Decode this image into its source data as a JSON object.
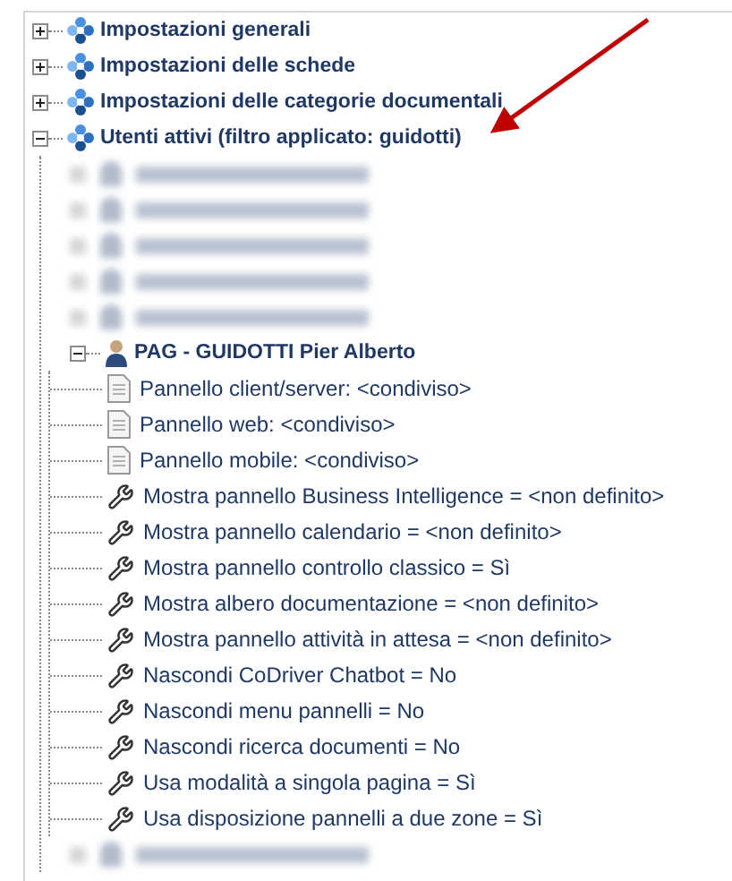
{
  "tree": [
    {
      "kind": "group",
      "label": "Impostazioni generali",
      "expanded": false
    },
    {
      "kind": "group",
      "label": "Impostazioni delle schede",
      "expanded": false
    },
    {
      "kind": "group",
      "label": "Impostazioni delle categorie documentali",
      "expanded": false
    },
    {
      "kind": "group",
      "label": "Utenti attivi (filtro applicato: guidotti)",
      "expanded": true,
      "children": [
        {
          "kind": "redacted"
        },
        {
          "kind": "redacted"
        },
        {
          "kind": "redacted"
        },
        {
          "kind": "redacted"
        },
        {
          "kind": "redacted"
        },
        {
          "kind": "user",
          "label": "PAG - GUIDOTTI Pier Alberto",
          "expanded": true,
          "children": [
            {
              "kind": "document",
              "label": "Pannello client/server: <condiviso>"
            },
            {
              "kind": "document",
              "label": "Pannello web: <condiviso>"
            },
            {
              "kind": "document",
              "label": "Pannello mobile: <condiviso>"
            },
            {
              "kind": "setting",
              "label": "Mostra pannello Business Intelligence = <non definito>"
            },
            {
              "kind": "setting",
              "label": "Mostra pannello calendario = <non definito>"
            },
            {
              "kind": "setting",
              "label": "Mostra pannello controllo classico = Sì"
            },
            {
              "kind": "setting",
              "label": "Mostra albero documentazione = <non definito>"
            },
            {
              "kind": "setting",
              "label": "Mostra pannello attività in attesa = <non definito>"
            },
            {
              "kind": "setting",
              "label": "Nascondi CoDriver Chatbot = No"
            },
            {
              "kind": "setting",
              "label": "Nascondi menu pannelli = No"
            },
            {
              "kind": "setting",
              "label": "Nascondi ricerca documenti = No"
            },
            {
              "kind": "setting",
              "label": "Usa modalità a singola pagina = Sì"
            },
            {
              "kind": "setting",
              "label": "Usa disposizione pannelli a due zone = Sì"
            }
          ]
        },
        {
          "kind": "redacted"
        }
      ]
    }
  ]
}
